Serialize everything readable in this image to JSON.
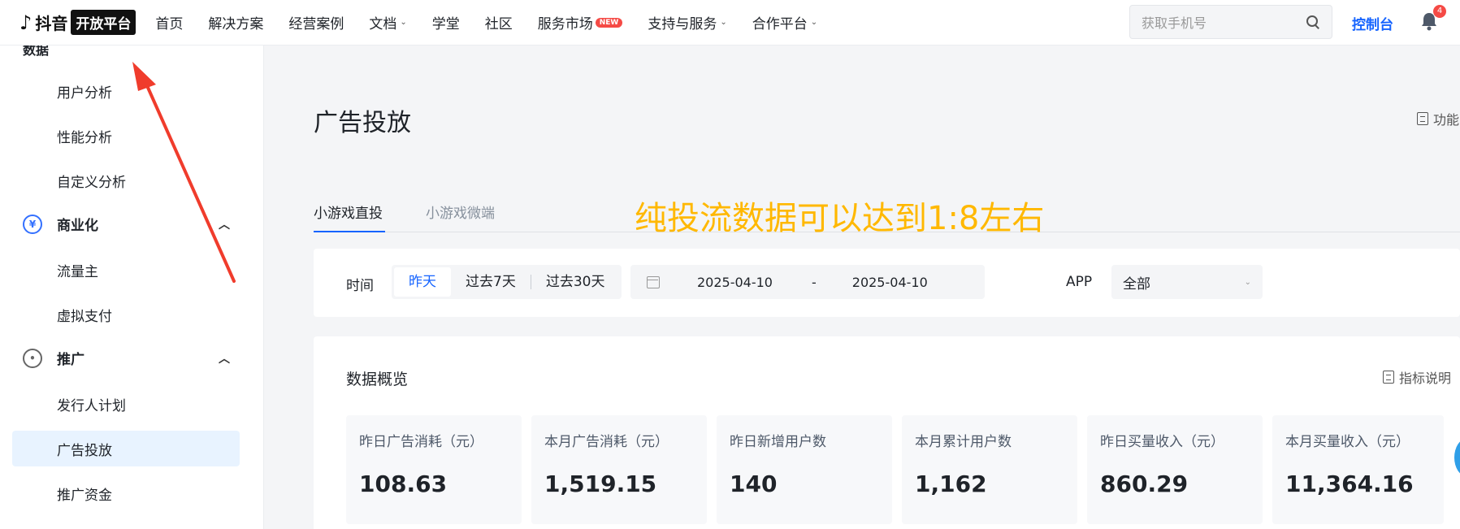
{
  "header": {
    "logo_note": "♪",
    "logo_brand": "抖音",
    "logo_platform": "开放平台",
    "nav": [
      {
        "label": "首页",
        "dropdown": false,
        "new": false
      },
      {
        "label": "解决方案",
        "dropdown": false,
        "new": false
      },
      {
        "label": "经营案例",
        "dropdown": false,
        "new": false
      },
      {
        "label": "文档",
        "dropdown": true,
        "new": false
      },
      {
        "label": "学堂",
        "dropdown": false,
        "new": false
      },
      {
        "label": "社区",
        "dropdown": false,
        "new": false
      },
      {
        "label": "服务市场",
        "dropdown": false,
        "new": true
      },
      {
        "label": "支持与服务",
        "dropdown": true,
        "new": false
      },
      {
        "label": "合作平台",
        "dropdown": true,
        "new": false
      }
    ],
    "new_badge": "NEW",
    "search_placeholder": "获取手机号",
    "console_label": "控制台",
    "notification_count": "4"
  },
  "sidebar": {
    "partial_label": "数据",
    "items": [
      {
        "label": "用户分析"
      },
      {
        "label": "性能分析"
      },
      {
        "label": "自定义分析"
      },
      {
        "label": "流量主"
      },
      {
        "label": "虚拟支付"
      },
      {
        "label": "发行人计划"
      },
      {
        "label": "广告投放"
      },
      {
        "label": "推广资金"
      }
    ],
    "groups": [
      {
        "label": "商业化",
        "icon": "yen-icon"
      },
      {
        "label": "推广",
        "icon": "broadcast-icon"
      }
    ]
  },
  "main": {
    "title": "广告投放",
    "func_link": "功能",
    "tabs": [
      {
        "label": "小游戏直投",
        "active": true
      },
      {
        "label": "小游戏微端",
        "active": false
      }
    ],
    "filter": {
      "time_label": "时间",
      "segments": [
        "昨天",
        "过去7天",
        "过去30天"
      ],
      "active_segment": "昨天",
      "date_start": "2025-04-10",
      "date_sep": "-",
      "date_end": "2025-04-10",
      "app_label": "APP",
      "app_value": "全部"
    },
    "overview": {
      "title": "数据概览",
      "link": "指标说明",
      "cards": [
        {
          "label": "昨日广告消耗（元）",
          "value": "108.63"
        },
        {
          "label": "本月广告消耗（元）",
          "value": "1,519.15"
        },
        {
          "label": "昨日新增用户数",
          "value": "140"
        },
        {
          "label": "本月累计用户数",
          "value": "1,162"
        },
        {
          "label": "昨日买量收入（元）",
          "value": "860.29"
        },
        {
          "label": "本月买量收入（元）",
          "value": "11,364.16"
        }
      ]
    }
  },
  "overlay_text": "纯投流数据可以达到1:8左右",
  "colors": {
    "accent": "#1664ff",
    "overlay": "#ffb800",
    "arrow": "#f03c2c"
  }
}
